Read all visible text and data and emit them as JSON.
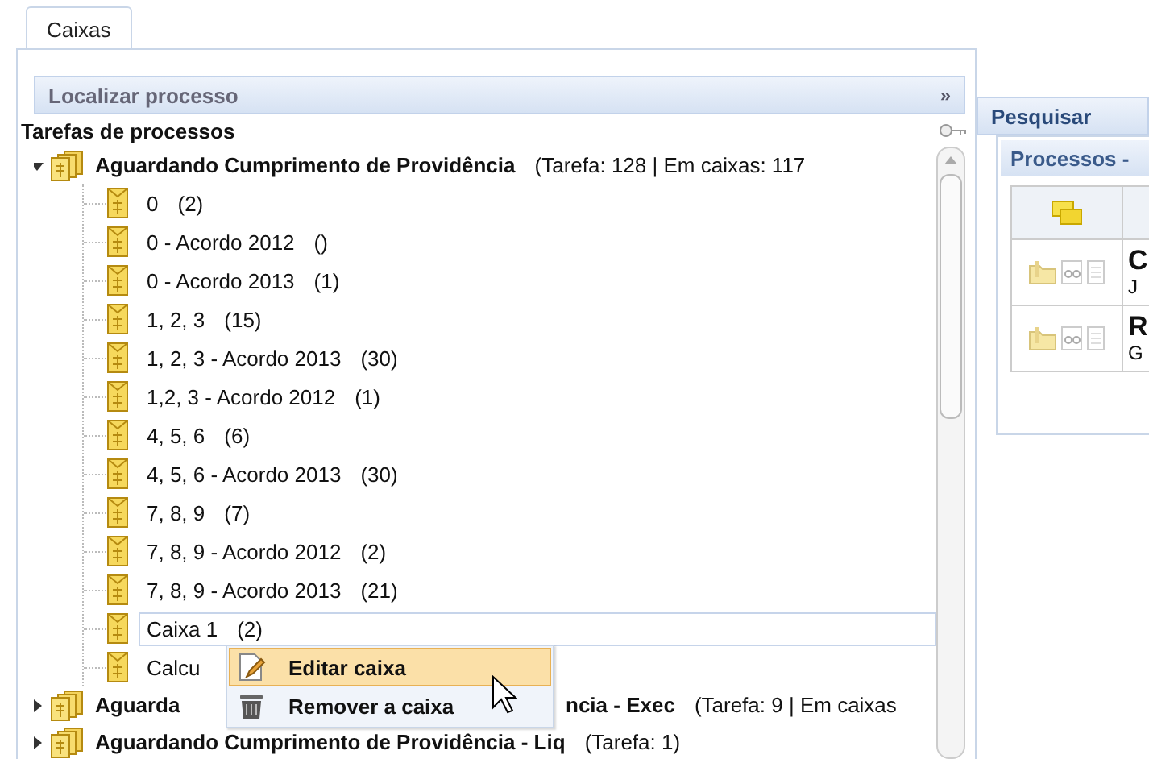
{
  "tabs": [
    {
      "label": "Caixas",
      "selected": true
    }
  ],
  "locate_bar": {
    "label": "Localizar processo",
    "toggle": "»"
  },
  "tree": {
    "title": "Tarefas de processos",
    "items": [
      {
        "label": "Aguardando Cumprimento de Providência",
        "info": "(Tarefa: 128 | Em caixas: 117",
        "expanded": true,
        "children": [
          {
            "label": "0",
            "count": "(2)",
            "selected": false
          },
          {
            "label": "0 - Acordo 2012",
            "count": "()",
            "selected": false
          },
          {
            "label": "0 - Acordo 2013",
            "count": "(1)",
            "selected": false
          },
          {
            "label": "1, 2, 3",
            "count": "(15)",
            "selected": false
          },
          {
            "label": "1, 2, 3 - Acordo 2013",
            "count": "(30)",
            "selected": false
          },
          {
            "label": "1,2, 3 - Acordo 2012",
            "count": "(1)",
            "selected": false
          },
          {
            "label": "4, 5, 6",
            "count": "(6)",
            "selected": false
          },
          {
            "label": "4, 5, 6 - Acordo 2013",
            "count": "(30)",
            "selected": false
          },
          {
            "label": "7, 8, 9",
            "count": "(7)",
            "selected": false
          },
          {
            "label": "7, 8, 9 - Acordo 2012",
            "count": "(2)",
            "selected": false
          },
          {
            "label": "7, 8, 9 - Acordo 2013",
            "count": "(21)",
            "selected": false
          },
          {
            "label": "Caixa 1",
            "count": "(2)",
            "selected": true
          },
          {
            "label": "Calcu",
            "selected": false
          }
        ]
      },
      {
        "label_parts": [
          "Aguarda",
          "ncia - Exec"
        ],
        "info": "(Tarefa: 9 | Em caixas",
        "expanded": false
      },
      {
        "label_parts": [
          "Aguardando Cumprimento de Providência - Liq"
        ],
        "info": "(Tarefa: 1)",
        "expanded": false
      }
    ]
  },
  "context_menu": [
    {
      "label": "Editar caixa",
      "kind": "edit",
      "selected": true
    },
    {
      "label": "Remover a caixa",
      "kind": "remove",
      "selected": false
    }
  ],
  "search_panel": {
    "title": "Pesquisar"
  },
  "processes": {
    "title": "Processos -",
    "rows": [
      {
        "title": "C",
        "subtitle": "J"
      },
      {
        "title": "R",
        "subtitle": "G"
      }
    ]
  }
}
